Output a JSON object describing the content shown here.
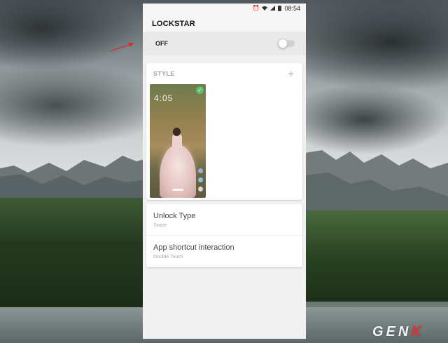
{
  "status_bar": {
    "icons": [
      "alarm-icon",
      "wifi-icon",
      "signal-icon",
      "battery-icon"
    ],
    "time": "08:54"
  },
  "app": {
    "title": "LOCKSTAR"
  },
  "master_switch": {
    "label": "OFF",
    "state": "off"
  },
  "style_section": {
    "title": "STYLE",
    "add_icon": "plus-icon",
    "thumbnail": {
      "clock": "4:05",
      "selected": true,
      "selected_icon": "check-icon"
    }
  },
  "settings": [
    {
      "title": "Unlock Type",
      "value": "Swipe"
    },
    {
      "title": "App shortcut interaction",
      "value": "Double Touch"
    }
  ],
  "annotation": {
    "arrow_color": "#d32f2f"
  },
  "watermark": {
    "text_main": "GEN",
    "text_accent": "K"
  },
  "colors": {
    "accent_green": "#5bbf6b",
    "arrow_red": "#d32f2f",
    "watermark_red": "#e8303a"
  }
}
